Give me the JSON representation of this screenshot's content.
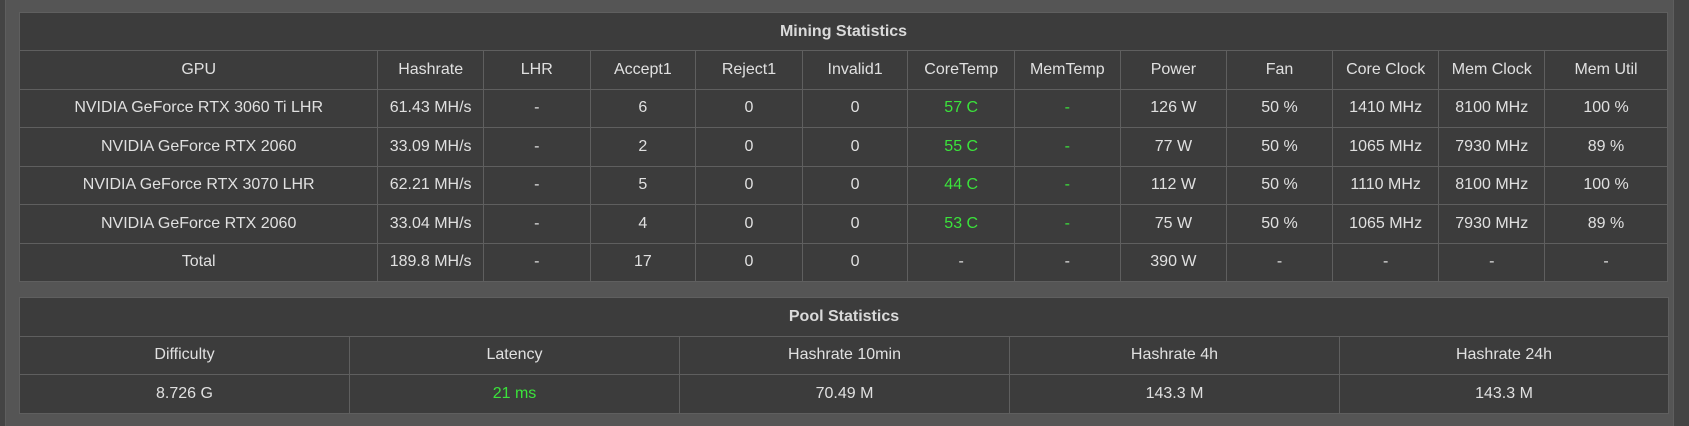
{
  "mining": {
    "title": "Mining Statistics",
    "headers": [
      "GPU",
      "Hashrate",
      "LHR",
      "Accept1",
      "Reject1",
      "Invalid1",
      "CoreTemp",
      "MemTemp",
      "Power",
      "Fan",
      "Core Clock",
      "Mem Clock",
      "Mem Util"
    ],
    "rows": [
      [
        "NVIDIA GeForce RTX 3060 Ti LHR",
        "61.43 MH/s",
        "-",
        "6",
        "0",
        "0",
        "57 C",
        "-",
        "126 W",
        "50 %",
        "1410 MHz",
        "8100 MHz",
        "100 %"
      ],
      [
        "NVIDIA GeForce RTX 2060",
        "33.09 MH/s",
        "-",
        "2",
        "0",
        "0",
        "55 C",
        "-",
        "77 W",
        "50 %",
        "1065 MHz",
        "7930 MHz",
        "89 %"
      ],
      [
        "NVIDIA GeForce RTX 3070 LHR",
        "62.21 MH/s",
        "-",
        "5",
        "0",
        "0",
        "44 C",
        "-",
        "112 W",
        "50 %",
        "1110 MHz",
        "8100 MHz",
        "100 %"
      ],
      [
        "NVIDIA GeForce RTX 2060",
        "33.04 MH/s",
        "-",
        "4",
        "0",
        "0",
        "53 C",
        "-",
        "75 W",
        "50 %",
        "1065 MHz",
        "7930 MHz",
        "89 %"
      ],
      [
        "Total",
        "189.8 MH/s",
        "-",
        "17",
        "0",
        "0",
        "-",
        "-",
        "390 W",
        "-",
        "-",
        "-",
        "-"
      ]
    ]
  },
  "pool": {
    "title": "Pool Statistics",
    "headers": [
      "Difficulty",
      "Latency",
      "Hashrate 10min",
      "Hashrate 4h",
      "Hashrate 24h"
    ],
    "values": [
      "8.726 G",
      "21 ms",
      "70.49 M",
      "143.3 M",
      "143.3 M"
    ]
  },
  "colors": {
    "background": "#444444",
    "panel": "#3c3c3c",
    "text": "#e0e0e0",
    "accent_green": "#3be33b"
  }
}
